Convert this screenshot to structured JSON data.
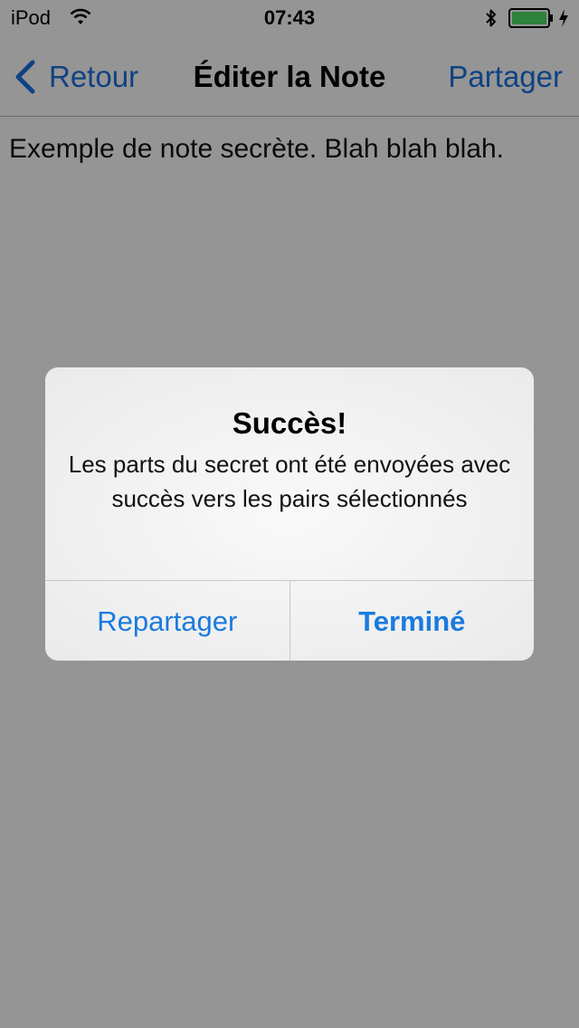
{
  "status_bar": {
    "carrier": "iPod",
    "time": "07:43",
    "icons": [
      "wifi-icon",
      "bluetooth-icon",
      "battery-icon",
      "charging-icon"
    ],
    "battery_color": "#4cd964"
  },
  "nav_bar": {
    "back_label": "Retour",
    "title": "Éditer la Note",
    "share_label": "Partager",
    "accent_color": "#1a6fd9"
  },
  "note": {
    "text": "Exemple de note secrète. Blah blah blah."
  },
  "alert": {
    "title": "Succès!",
    "message": "Les parts du secret ont été envoyées avec succès vers les pairs sélectionnés",
    "buttons": [
      {
        "label": "Repartager",
        "style": "normal"
      },
      {
        "label": "Terminé",
        "style": "bold"
      }
    ],
    "button_color": "#1a7be0"
  }
}
